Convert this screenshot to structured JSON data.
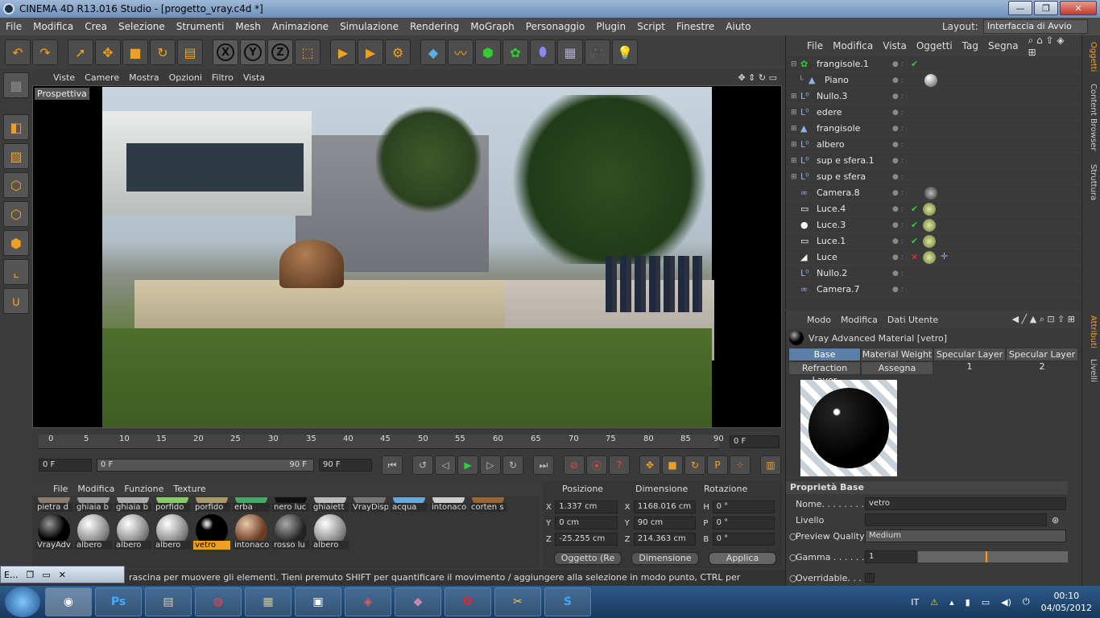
{
  "window": {
    "title": "CINEMA 4D R13.016 Studio - [progetto_vray.c4d *]",
    "min": "—",
    "max": "❐",
    "close": "✕"
  },
  "menu": [
    "File",
    "Modifica",
    "Crea",
    "Selezione",
    "Strumenti",
    "Mesh",
    "Animazione",
    "Simulazione",
    "Rendering",
    "MoGraph",
    "Personaggio",
    "Plugin",
    "Script",
    "Finestre",
    "Aiuto"
  ],
  "layout": {
    "label": "Layout:",
    "value": "Interfaccia di Avvio"
  },
  "toolbar": {
    "x": "X",
    "y": "Y",
    "z": "Z"
  },
  "viewport": {
    "menu": [
      "Viste",
      "Camere",
      "Mostra",
      "Opzioni",
      "Filtro",
      "Vista"
    ],
    "label": "Prospettiva"
  },
  "timeline": {
    "ticks": [
      "0",
      "5",
      "10",
      "15",
      "20",
      "25",
      "30",
      "35",
      "40",
      "45",
      "50",
      "55",
      "60",
      "65",
      "70",
      "75",
      "80",
      "85",
      "90"
    ],
    "frame": "0 F"
  },
  "anim": {
    "start": "0 F",
    "slider_start": "0 F",
    "slider_end": "90 F",
    "end": "90 F"
  },
  "materials": {
    "menu": [
      "File",
      "Modifica",
      "Funzione",
      "Texture"
    ],
    "row1": [
      "pietra d",
      "ghiaia b",
      "ghiaia b",
      "porfido",
      "porfido",
      "erba",
      "nero luc",
      "ghiaiett",
      "VrayDisp",
      "acqua",
      "intonaco",
      "corten s"
    ],
    "row2": [
      "VrayAdv",
      "albero",
      "albero",
      "albero",
      "vetro",
      "intonaco",
      "rosso lu",
      "albero"
    ]
  },
  "coords": {
    "headers": [
      "Posizione",
      "Dimensione",
      "Rotazione"
    ],
    "rows": [
      {
        "a1": "X",
        "v1": "1.337 cm",
        "a2": "X",
        "v2": "1168.016 cm",
        "a3": "H",
        "v3": "0 °"
      },
      {
        "a1": "Y",
        "v1": "0 cm",
        "a2": "Y",
        "v2": "90 cm",
        "a3": "P",
        "v3": "0 °"
      },
      {
        "a1": "Z",
        "v1": "-25.255 cm",
        "a2": "Z",
        "v2": "214.363 cm",
        "a3": "B",
        "v3": "0 °"
      }
    ],
    "mode1": "Oggetto (Re",
    "mode2": "Dimensione",
    "apply": "Applica"
  },
  "status": "rascina per muovere gli elementi. Tieni premuto SHIFT per quantificare il movimento / aggiungere alla selezione in modo punto, CTRL per rimuovere.",
  "minwin": {
    "label": "E..."
  },
  "objmgr": {
    "menu": [
      "File",
      "Modifica",
      "Vista",
      "Oggetti",
      "Tag",
      "Segna"
    ],
    "objects": [
      "frangisole.1",
      "Piano",
      "Nullo.3",
      "edere",
      "frangisole",
      "albero",
      "sup e sfera.1",
      "sup e sfera",
      "Camera.8",
      "Luce.4",
      "Luce.3",
      "Luce.1",
      "Luce",
      "Nullo.2",
      "Camera.7"
    ]
  },
  "sidetabs": [
    "Oggetti",
    "Content Browser",
    "Struttura",
    "Attributi",
    "Livelli"
  ],
  "attr": {
    "menu": [
      "Modo",
      "Modifica",
      "Dati Utente"
    ],
    "title": "Vray Advanced Material [vetro]",
    "tabs": [
      "Base",
      "Material Weight",
      "Specular Layer 1",
      "Specular Layer 2",
      "Refraction Layer",
      "Assegna"
    ],
    "section": "Proprietà Base",
    "props": {
      "name_label": "Nome. . . . . . . .",
      "name_value": "vetro",
      "level_label": "Livello",
      "preview_label": "Preview Quality",
      "preview_value": "Medium",
      "gamma_label": "Gamma . . . . . .",
      "gamma_value": "1",
      "override_label": "Overridable. . ."
    }
  },
  "tray": {
    "lang": "IT",
    "time": "00:10",
    "date": "04/05/2012"
  },
  "taskbar": {
    "ps": "Ps"
  }
}
